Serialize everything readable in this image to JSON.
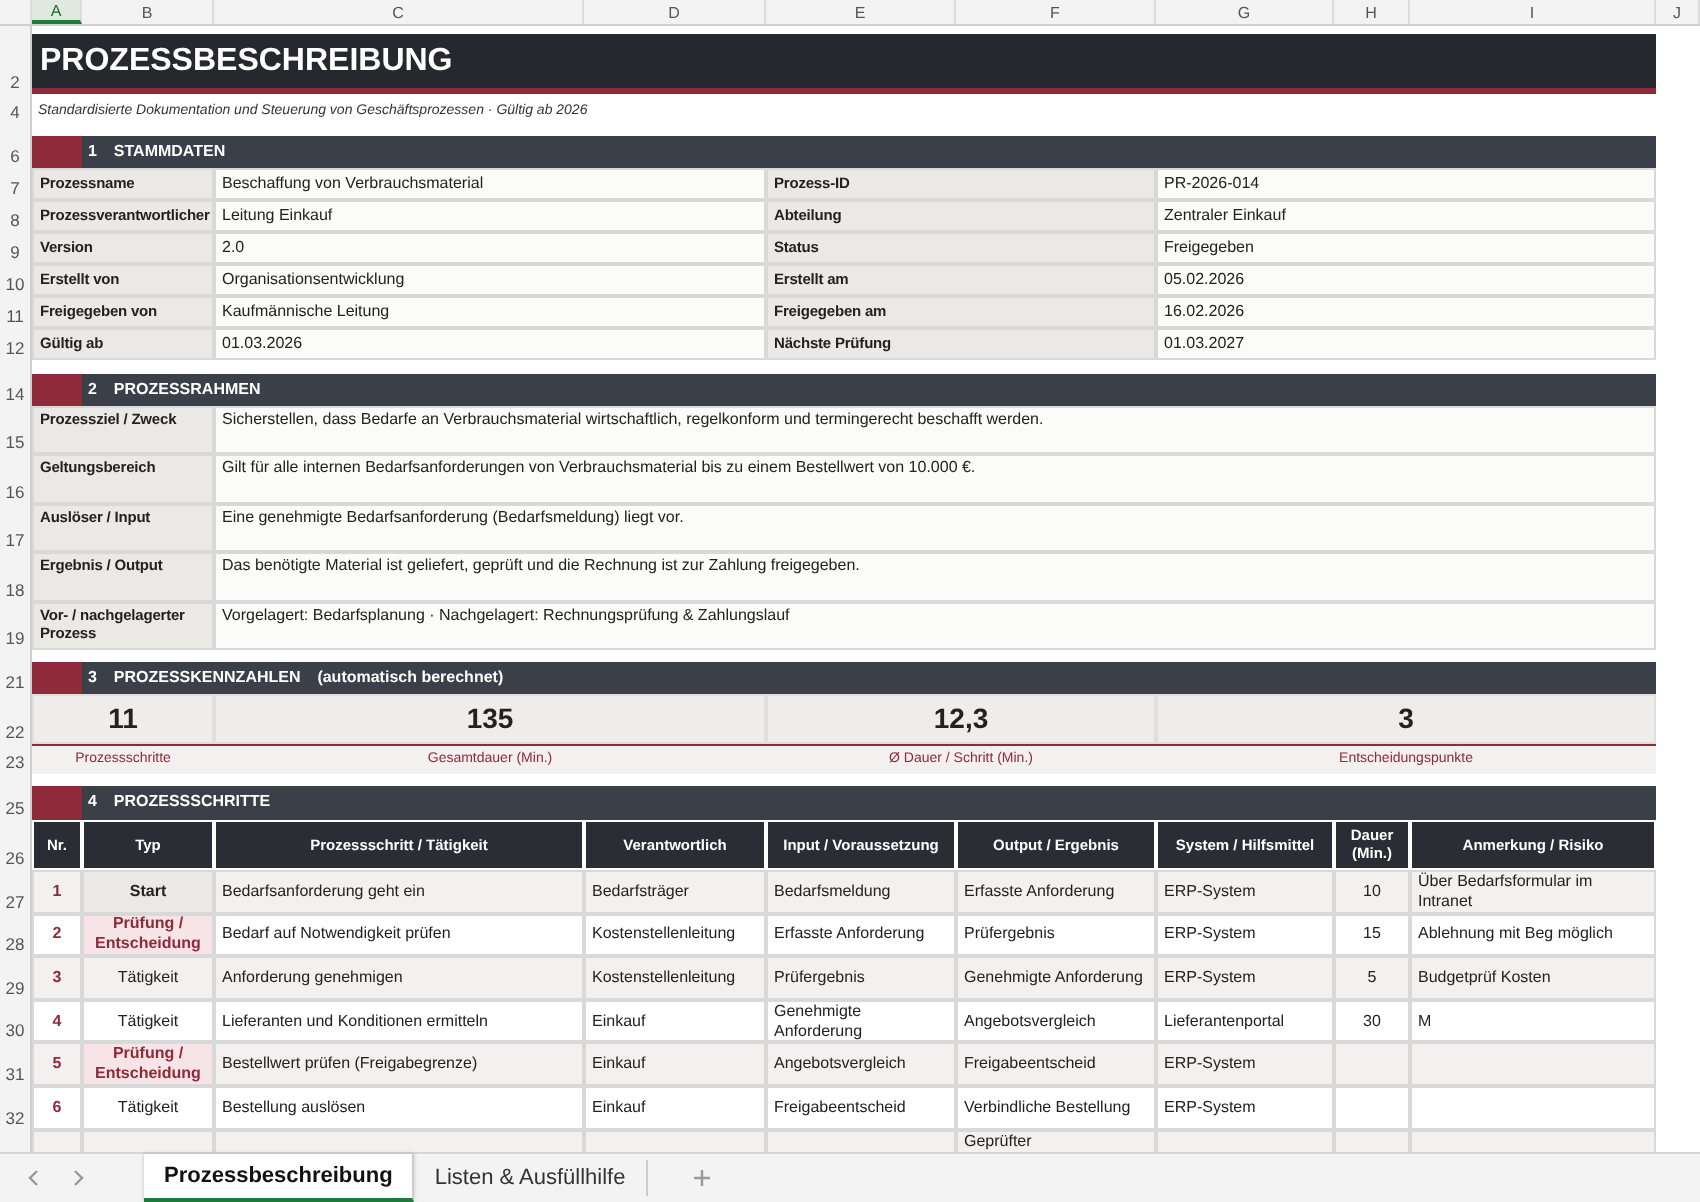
{
  "column_headers": [
    "A",
    "B",
    "C",
    "D",
    "E",
    "F",
    "G",
    "H",
    "I",
    "J"
  ],
  "title": {
    "row": "2",
    "text": "PROZESSBESCHREIBUNG"
  },
  "subtitle": {
    "row": "4",
    "text": "Standardisierte Dokumentation und Steuerung von Geschäftsprozessen  ·  Gültig ab 2026"
  },
  "stammdaten": {
    "row": "6",
    "number": "1",
    "heading": "STAMMDATEN",
    "rows": [
      {
        "row": "7",
        "label": "Prozessname",
        "value": "Beschaffung von Verbrauchsmaterial",
        "label_2": "Prozess-ID",
        "value_2": "PR-2026-014"
      },
      {
        "row": "8",
        "label": "Prozessverantwortlicher",
        "value": "Leitung Einkauf",
        "label_2": "Abteilung",
        "value_2": "Zentraler Einkauf"
      },
      {
        "row": "9",
        "label": "Version",
        "value": "2.0",
        "label_2": "Status",
        "value_2": "Freigegeben"
      },
      {
        "row": "10",
        "label": "Erstellt von",
        "value": "Organisationsentwicklung",
        "label_2": "Erstellt am",
        "value_2": "05.02.2026"
      },
      {
        "row": "11",
        "label": "Freigegeben von",
        "value": "Kaufmännische Leitung",
        "label_2": "Freigegeben am",
        "value_2": "16.02.2026"
      },
      {
        "row": "12",
        "label": "Gültig ab",
        "value": "01.03.2026",
        "label_2": "Nächste Prüfung",
        "value_2": "01.03.2027"
      }
    ]
  },
  "prozessrahmen": {
    "row": "14",
    "number": "2",
    "heading": "PROZESSRAHMEN",
    "rows": [
      {
        "row": "15",
        "label": "Prozessziel / Zweck",
        "value": "Sicherstellen, dass Bedarfe an Verbrauchsmaterial wirtschaftlich, regelkonform und termingerecht beschafft werden."
      },
      {
        "row": "16",
        "label": "Geltungsbereich",
        "value": "Gilt für alle internen Bedarfsanforderungen von Verbrauchsmaterial bis zu einem Bestellwert von 10.000 €."
      },
      {
        "row": "17",
        "label": "Auslöser / Input",
        "value": "Eine genehmigte Bedarfsanforderung (Bedarfsmeldung) liegt vor."
      },
      {
        "row": "18",
        "label": "Ergebnis / Output",
        "value": "Das benötigte Material ist geliefert, geprüft und die Rechnung ist zur Zahlung freigegeben."
      },
      {
        "row": "19",
        "label": "Vor- / nachgelagerter Prozess",
        "value": "Vorgelagert: Bedarfsplanung   ·   Nachgelagert: Rechnungsprüfung & Zahlungslauf"
      }
    ]
  },
  "kennzahlen": {
    "row": "21",
    "number": "3",
    "heading": "PROZESSKENNZAHLEN",
    "note": "(automatisch berechnet)",
    "value_row": "22",
    "label_row": "23",
    "metrics": [
      {
        "value": "11",
        "label": "Prozessschritte"
      },
      {
        "value": "135",
        "label": "Gesamtdauer (Min.)"
      },
      {
        "value": "12,3",
        "label": "Ø Dauer / Schritt (Min.)"
      },
      {
        "value": "3",
        "label": "Entscheidungspunkte"
      }
    ]
  },
  "prozessschritte": {
    "row": "25",
    "number": "4",
    "heading": "PROZESSSCHRITTE",
    "header_row": "26",
    "columns": [
      "Nr.",
      "Typ",
      "Prozessschritt / Tätigkeit",
      "Verantwortlich",
      "Input / Voraussetzung",
      "Output / Ergebnis",
      "System / Hilfsmittel",
      "Dauer (Min.)",
      "Anmerkung / Risiko"
    ],
    "rows": [
      {
        "row": "27",
        "nr": "1",
        "kind": "start",
        "typ": "Start",
        "step": "Bedarfsanforderung geht ein",
        "owner": "Bedarfsträger",
        "input": "Bedarfsmeldung",
        "output": "Erfasste Anforderung",
        "system": "ERP-System",
        "duration": "10",
        "remark": "Über Bedarfsformular im Intranet"
      },
      {
        "row": "28",
        "nr": "2",
        "kind": "decision",
        "typ": "Prüfung / Entscheidung",
        "step": "Bedarf auf Notwendigkeit prüfen",
        "owner": "Kostenstellenleitung",
        "input": "Erfasste Anforderung",
        "output": "Prüfergebnis",
        "system": "ERP-System",
        "duration": "15",
        "remark": "Ablehnung mit Beg möglich"
      },
      {
        "row": "29",
        "nr": "3",
        "kind": "activity",
        "typ": "Tätigkeit",
        "step": "Anforderung genehmigen",
        "owner": "Kostenstellenleitung",
        "input": "Prüfergebnis",
        "output": "Genehmigte Anforderung",
        "system": "ERP-System",
        "duration": "5",
        "remark": "Budgetprüf Kosten"
      },
      {
        "row": "30",
        "nr": "4",
        "kind": "activity",
        "typ": "Tätigkeit",
        "step": "Lieferanten und Konditionen ermitteln",
        "owner": "Einkauf",
        "input": "Genehmigte Anforderung",
        "output": "Angebotsvergleich",
        "system": "Lieferantenportal",
        "duration": "30",
        "remark": "M"
      },
      {
        "row": "31",
        "nr": "5",
        "kind": "decision",
        "typ": "Prüfung / Entscheidung",
        "step": "Bestellwert prüfen (Freigabegrenze)",
        "owner": "Einkauf",
        "input": "Angebotsvergleich",
        "output": "Freigabeentscheid",
        "system": "ERP-System"
      },
      {
        "row": "32",
        "nr": "6",
        "kind": "activity",
        "typ": "Tätigkeit",
        "step": "Bestellung auslösen",
        "owner": "Einkauf",
        "input": "Freigabeentscheid",
        "output": "Verbindliche Bestellung",
        "system": "ERP-System"
      },
      {
        "output": "Geprüfter"
      }
    ]
  },
  "sheet_tabs": [
    {
      "label": "Prozessbeschreibung",
      "selected": true
    },
    {
      "label": "Listen & Ausfüllhilfe",
      "selected": false
    }
  ]
}
